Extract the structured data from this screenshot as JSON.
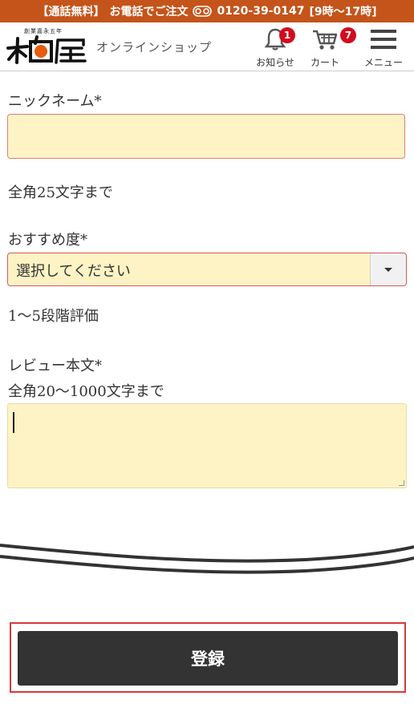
{
  "topbar": {
    "free_call": "【通話無料】",
    "order_by_phone": "お電話でご注文",
    "phone": "0120-39-0147",
    "hours": "[9時～17時]",
    "freedial_icon": "freedial-icon"
  },
  "header": {
    "logo_sub": "創業嘉永五年",
    "logo_alt": "柏屋",
    "shop_label": "オンラインショップ",
    "notices": {
      "label": "お知らせ",
      "count": "1",
      "icon": "bell-icon"
    },
    "cart": {
      "label": "カート",
      "count": "7",
      "icon": "cart-icon"
    },
    "menu": {
      "label": "メニュー",
      "icon": "hamburger-icon"
    },
    "badge_color": "#d40b1f",
    "brand_color": "#c4541a"
  },
  "form": {
    "nickname": {
      "label": "ニックネーム*",
      "value": "",
      "note": "全角25文字まで"
    },
    "rating": {
      "label": "おすすめ度*",
      "selected": "選択してください",
      "note": "1～5段階評価"
    },
    "review": {
      "label": "レビュー本文*",
      "note": "全角20～1000文字まで",
      "value": ""
    },
    "input_bg": "#fdf3c4"
  },
  "submit": {
    "label": "登録"
  }
}
